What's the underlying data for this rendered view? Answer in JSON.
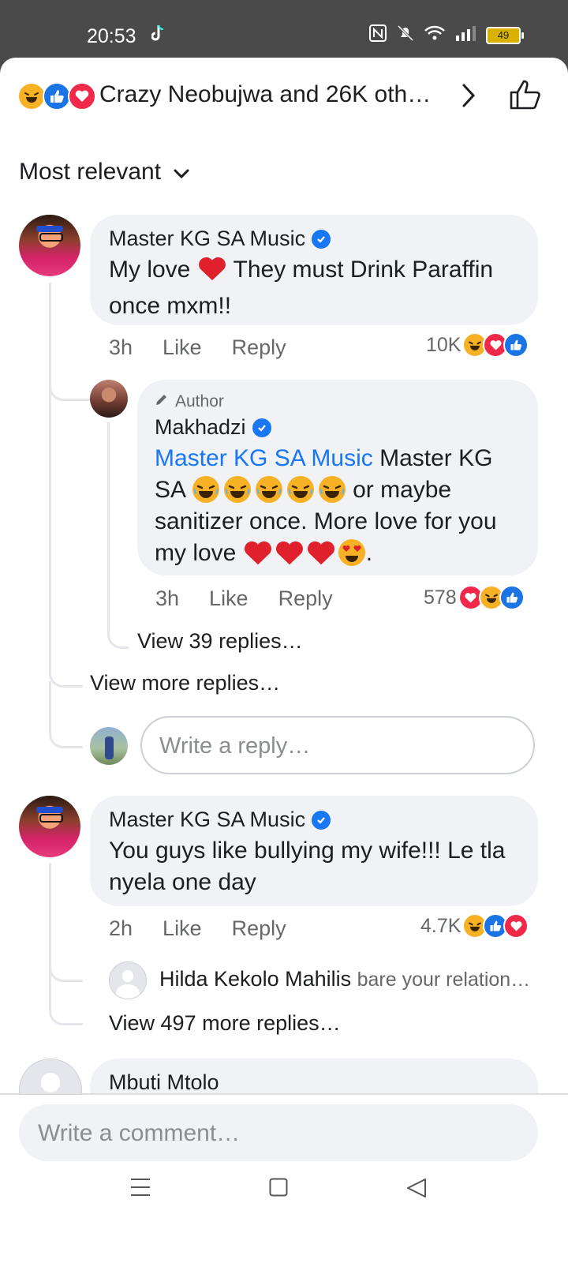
{
  "status_bar": {
    "time": "20:53",
    "battery": "49",
    "icons": [
      "tiktok-icon",
      "nfc-icon",
      "mute-icon",
      "wifi-icon",
      "signal-icon",
      "battery-icon"
    ]
  },
  "header": {
    "reactions": [
      "haha",
      "like",
      "love"
    ],
    "summary": "Crazy Neobujwa and 26K oth…"
  },
  "sort": {
    "label": "Most relevant"
  },
  "comments": [
    {
      "author": "Master KG SA Music",
      "verified": true,
      "text_before_heart": "My love",
      "text_after_heart": "They must Drink Paraffin once mxm!!",
      "time": "3h",
      "like_label": "Like",
      "reply_label": "Reply",
      "reaction_count": "10K",
      "reactions": [
        "haha",
        "love",
        "like"
      ]
    },
    {
      "badge": "Author",
      "author": "Makhadzi",
      "verified": true,
      "mention": "Master KG SA Music",
      "text_line1": "Master KG SA",
      "text_mid": "or maybe sanitizer once. More love for you my love",
      "time": "3h",
      "like_label": "Like",
      "reply_label": "Reply",
      "reaction_count": "578",
      "reactions": [
        "love",
        "haha",
        "like"
      ],
      "view_replies": "View 39 replies…"
    }
  ],
  "view_more_replies": "View more replies…",
  "reply_placeholder": "Write a reply…",
  "comment2": {
    "author": "Master KG SA Music",
    "verified": true,
    "text": "You guys like bullying my wife!!! Le tla nyela one day",
    "time": "2h",
    "like_label": "Like",
    "reply_label": "Reply",
    "reaction_count": "4.7K",
    "reactions": [
      "haha",
      "like",
      "love"
    ],
    "reply_author": "Hilda Kekolo Mahilis",
    "reply_snippet": "bare your relation…",
    "view_more": "View 497 more replies…"
  },
  "comment3": {
    "author": "Mbuti Mtolo"
  },
  "comment_placeholder": "Write a comment…",
  "colors": {
    "like": "#1b74e4",
    "love": "#f02849",
    "haha": "#f7b125",
    "link": "#1877f2"
  }
}
